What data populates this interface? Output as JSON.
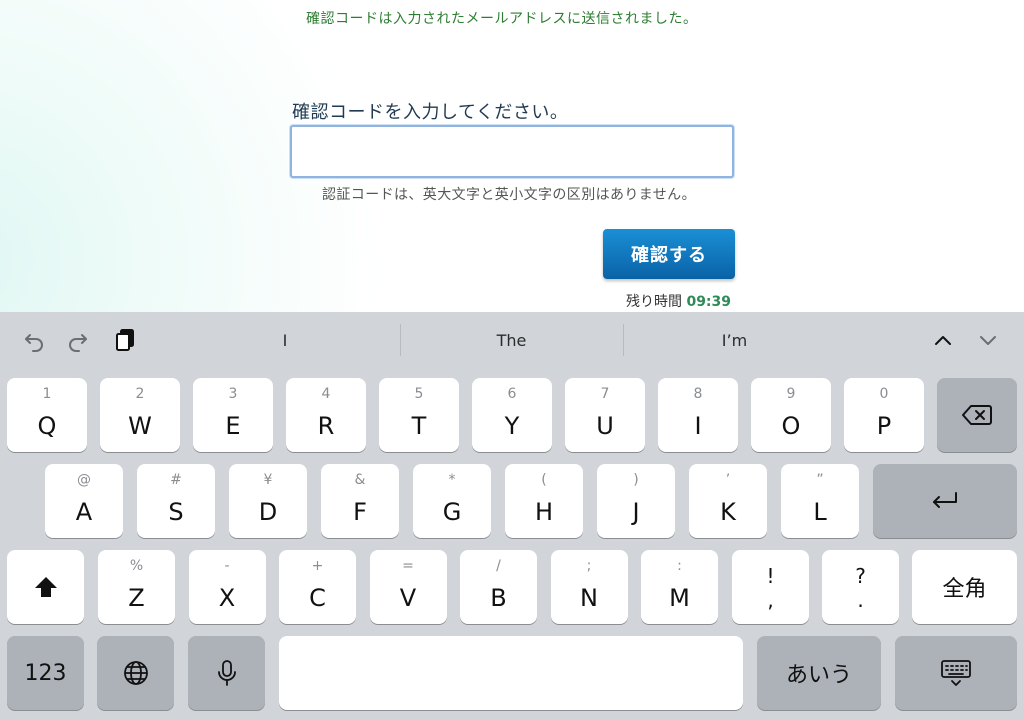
{
  "page": {
    "sent_notice": "確認コードは入力されたメールアドレスに送信されました。",
    "code_label": "確認コードを入力してください。",
    "code_value": "",
    "case_note": "認証コードは、英大文字と英小文字の区別はありません。",
    "confirm_label": "確認する",
    "timer_label": "残り時間",
    "timer_value": "09:39",
    "colors": {
      "accent": "#0a62a6",
      "notice": "#2e7d32",
      "timer": "#2e8b57"
    }
  },
  "keyboard": {
    "suggestions": [
      "I",
      "The",
      "I’m"
    ],
    "row1": [
      {
        "hint": "1",
        "label": "Q"
      },
      {
        "hint": "2",
        "label": "W"
      },
      {
        "hint": "3",
        "label": "E"
      },
      {
        "hint": "4",
        "label": "R"
      },
      {
        "hint": "5",
        "label": "T"
      },
      {
        "hint": "6",
        "label": "Y"
      },
      {
        "hint": "7",
        "label": "U"
      },
      {
        "hint": "8",
        "label": "I"
      },
      {
        "hint": "9",
        "label": "O"
      },
      {
        "hint": "0",
        "label": "P"
      }
    ],
    "row2": [
      {
        "hint": "@",
        "label": "A"
      },
      {
        "hint": "#",
        "label": "S"
      },
      {
        "hint": "¥",
        "label": "D"
      },
      {
        "hint": "&",
        "label": "F"
      },
      {
        "hint": "*",
        "label": "G"
      },
      {
        "hint": "(",
        "label": "H"
      },
      {
        "hint": ")",
        "label": "J"
      },
      {
        "hint": "’",
        "label": "K"
      },
      {
        "hint": "”",
        "label": "L"
      }
    ],
    "row3": [
      {
        "hint": "%",
        "label": "Z"
      },
      {
        "hint": "-",
        "label": "X"
      },
      {
        "hint": "+",
        "label": "C"
      },
      {
        "hint": "=",
        "label": "V"
      },
      {
        "hint": "/",
        "label": "B"
      },
      {
        "hint": ";",
        "label": "N"
      },
      {
        "hint": ":",
        "label": "M"
      }
    ],
    "punct1": {
      "top": "!",
      "bottom": ","
    },
    "punct2": {
      "top": "?",
      "bottom": "."
    },
    "fullwidth_label": "全角",
    "numbers_label": "123",
    "kana_label": "あいう",
    "icons": {
      "undo": "undo-icon",
      "redo": "redo-icon",
      "paste": "paste-icon",
      "up": "chevron-up-icon",
      "down": "chevron-down-icon",
      "delete": "delete-icon",
      "return": "return-icon",
      "shift": "shift-icon",
      "globe": "globe-icon",
      "mic": "microphone-icon",
      "dismiss": "keyboard-dismiss-icon"
    }
  }
}
